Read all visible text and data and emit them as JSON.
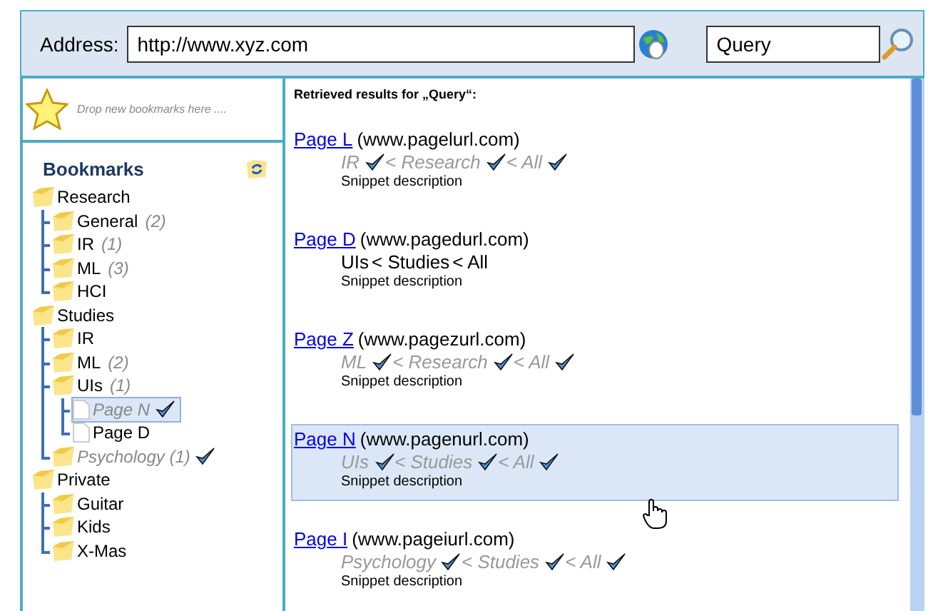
{
  "address_bar": {
    "label": "Address:",
    "value": "http://www.xyz.com"
  },
  "search": {
    "value": "Query"
  },
  "drop_zone": {
    "hint": "Drop new bookmarks here ...."
  },
  "bookmarks": {
    "title": "Bookmarks",
    "tree": [
      {
        "kind": "folder",
        "label": "Research",
        "checked": false,
        "selected": false,
        "muted": false,
        "children": [
          {
            "kind": "folder",
            "label": "General",
            "count": "(2)",
            "checked": false,
            "selected": false,
            "muted": false
          },
          {
            "kind": "folder",
            "label": "IR",
            "count": "(1)",
            "checked": false,
            "selected": false,
            "muted": false
          },
          {
            "kind": "folder",
            "label": "ML",
            "count": "(3)",
            "checked": false,
            "selected": false,
            "muted": false
          },
          {
            "kind": "folder",
            "label": "HCI",
            "checked": false,
            "selected": false,
            "muted": false
          }
        ]
      },
      {
        "kind": "folder",
        "label": "Studies",
        "checked": false,
        "selected": false,
        "muted": false,
        "children": [
          {
            "kind": "folder",
            "label": "IR",
            "checked": false,
            "selected": false,
            "muted": false
          },
          {
            "kind": "folder",
            "label": "ML",
            "count": "(2)",
            "checked": false,
            "selected": false,
            "muted": false
          },
          {
            "kind": "folder",
            "label": "UIs",
            "count": "(1)",
            "checked": false,
            "selected": false,
            "muted": false,
            "children": [
              {
                "kind": "page",
                "label": "Page N",
                "checked": true,
                "selected": true,
                "muted": true
              },
              {
                "kind": "page",
                "label": "Page D",
                "checked": false,
                "selected": false,
                "muted": false
              }
            ]
          },
          {
            "kind": "folder",
            "label": "Psychology (1)",
            "checked": true,
            "selected": false,
            "muted": true
          }
        ]
      },
      {
        "kind": "folder",
        "label": "Private",
        "checked": false,
        "selected": false,
        "muted": false,
        "children": [
          {
            "kind": "folder",
            "label": "Guitar",
            "checked": false,
            "selected": false,
            "muted": false
          },
          {
            "kind": "folder",
            "label": "Kids",
            "checked": false,
            "selected": false,
            "muted": false
          },
          {
            "kind": "folder",
            "label": "X-Mas",
            "checked": false,
            "selected": false,
            "muted": false
          }
        ]
      }
    ]
  },
  "results": {
    "heading": "Retrieved results for „Query“:",
    "items": [
      {
        "title": "Page L",
        "url": "(www.pagelurl.com)",
        "muted": true,
        "selected": false,
        "snippet": "Snippet description",
        "path": [
          {
            "label": "IR",
            "checked": true
          },
          {
            "label": "< Research",
            "checked": true
          },
          {
            "label": "< All",
            "checked": true
          }
        ]
      },
      {
        "title": "Page D",
        "url": "(www.pagedurl.com)",
        "muted": false,
        "selected": false,
        "snippet": "Snippet description",
        "path": [
          {
            "label": "UIs",
            "checked": false
          },
          {
            "label": "< Studies",
            "checked": false
          },
          {
            "label": "< All",
            "checked": false
          }
        ]
      },
      {
        "title": "Page Z",
        "url": "(www.pagezurl.com)",
        "muted": true,
        "selected": false,
        "snippet": "Snippet description",
        "path": [
          {
            "label": "ML",
            "checked": true
          },
          {
            "label": "< Research",
            "checked": true
          },
          {
            "label": "< All",
            "checked": true
          }
        ]
      },
      {
        "title": "Page N",
        "url": "(www.pagenurl.com)",
        "muted": true,
        "selected": true,
        "snippet": "Snippet description",
        "path": [
          {
            "label": "UIs",
            "checked": true
          },
          {
            "label": "< Studies",
            "checked": true
          },
          {
            "label": "< All",
            "checked": true
          }
        ]
      },
      {
        "title": "Page I",
        "url": "(www.pageiurl.com)",
        "muted": true,
        "selected": false,
        "snippet": "Snippet description",
        "path": [
          {
            "label": "Psychology",
            "checked": true
          },
          {
            "label": "< Studies",
            "checked": true
          },
          {
            "label": "< All",
            "checked": true
          }
        ]
      }
    ]
  }
}
